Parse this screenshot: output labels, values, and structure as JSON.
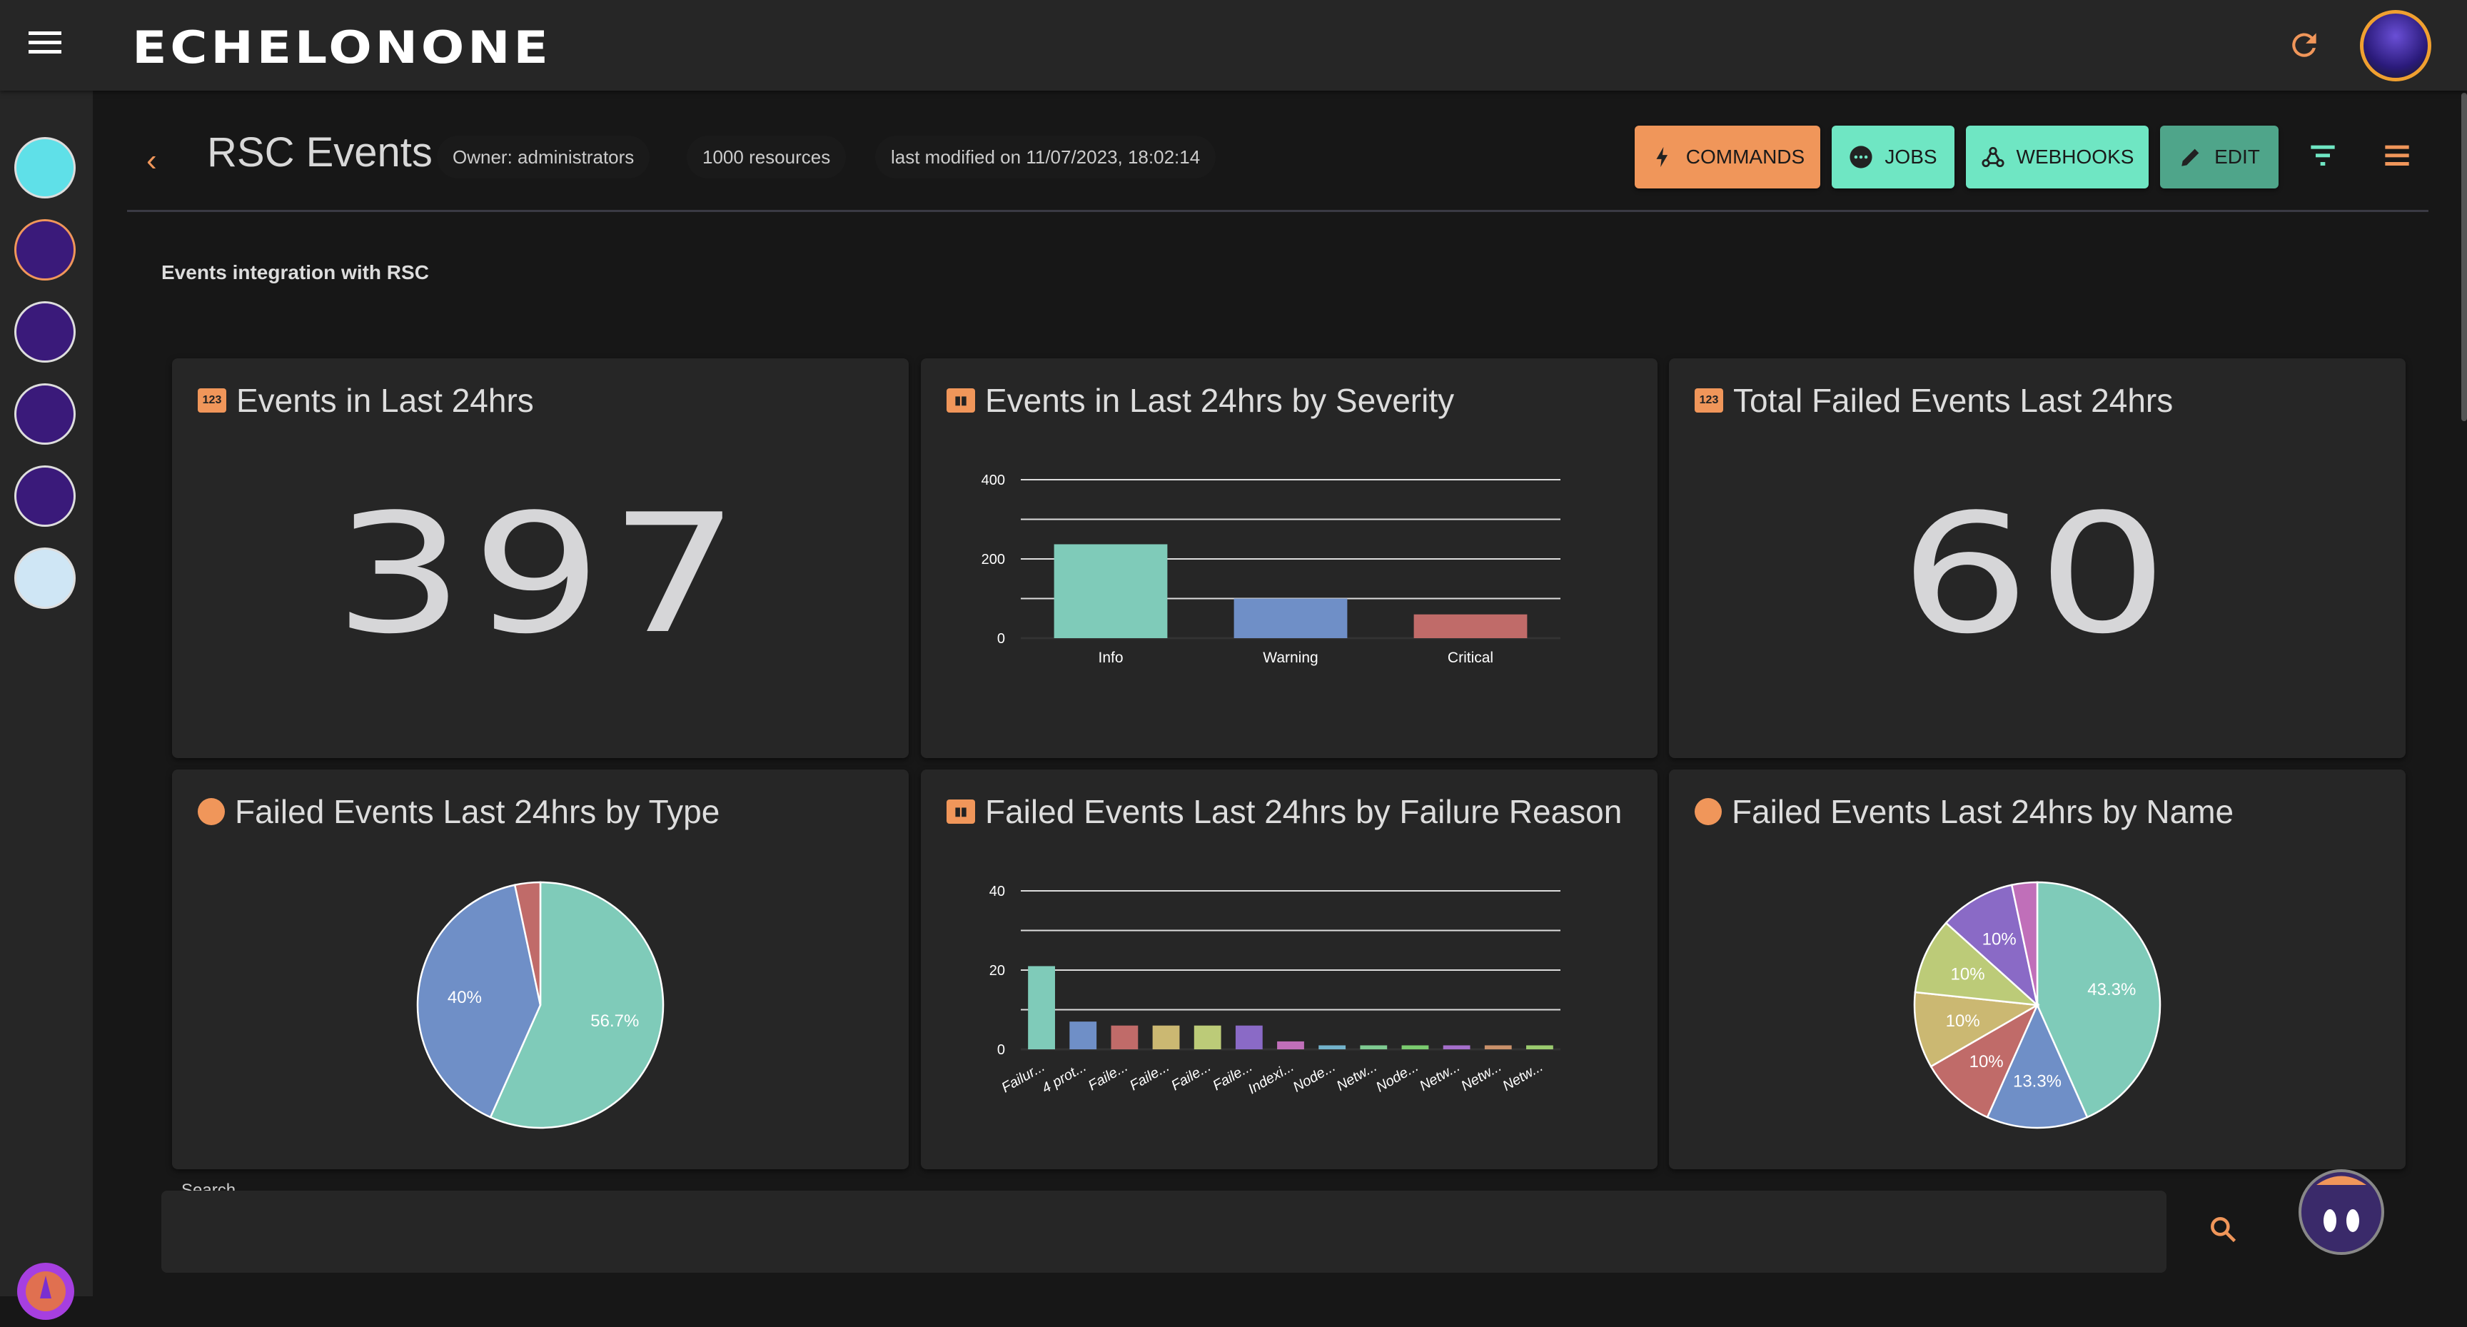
{
  "app": {
    "logo": "ECHELONONE"
  },
  "header": {
    "title": "RSC Events",
    "owner": "Owner: administrators",
    "resources": "1000 resources",
    "modified": "last modified on 11/07/2023, 18:02:14",
    "buttons": {
      "commands": "COMMANDS",
      "jobs": "JOBS",
      "webhooks": "WEBHOOKS",
      "edit": "EDIT"
    }
  },
  "subtitle": "Events integration with RSC",
  "colors": {
    "accent": "#f0965a",
    "mint": "#6fe6c3",
    "edit": "#4fa58a"
  },
  "cards": {
    "events_24h": {
      "title": "Events in Last 24hrs",
      "value": "397",
      "icon": "123"
    },
    "failed_total": {
      "title": "Total Failed Events Last 24hrs",
      "value": "60",
      "icon": "123"
    },
    "severity": {
      "title": "Events in Last 24hrs by Severity"
    },
    "by_type": {
      "title": "Failed Events Last 24hrs by Type"
    },
    "by_reason": {
      "title": "Failed Events Last 24hrs by Failure Reason"
    },
    "by_name": {
      "title": "Failed Events Last 24hrs by Name"
    }
  },
  "search": {
    "placeholder": "Search..."
  },
  "chart_data": [
    {
      "type": "bar",
      "title": "Events in Last 24hrs by Severity",
      "categories": [
        "Info",
        "Warning",
        "Critical"
      ],
      "values": [
        237,
        100,
        60
      ],
      "colors": [
        "#7fcbb9",
        "#6f8fc7",
        "#c06b69"
      ],
      "yticks": [
        0,
        200,
        400
      ],
      "ylim": [
        0,
        400
      ],
      "grid": true
    },
    {
      "type": "pie",
      "title": "Failed Events Last 24hrs by Type",
      "values": [
        34,
        24,
        2
      ],
      "labels": [
        "56.7%",
        "40%",
        ""
      ],
      "colors": [
        "#7fcbb9",
        "#6f8fc7",
        "#c06b69"
      ]
    },
    {
      "type": "bar",
      "title": "Failed Events Last 24hrs by Failure Reason",
      "categories": [
        "Failur...",
        "4 prot...",
        "Faile...",
        "Faile...",
        "Faile...",
        "Faile...",
        "Indexi...",
        "Node...",
        "Netw...",
        "Node...",
        "Netw...",
        "Netw...",
        "Netw..."
      ],
      "values": [
        21,
        7,
        6,
        6,
        6,
        6,
        2,
        1,
        1,
        1,
        1,
        1,
        1
      ],
      "colors": [
        "#7fcbb9",
        "#6f8fc7",
        "#c06b69",
        "#cbb872",
        "#bccb78",
        "#8a6ac6",
        "#c06fb9",
        "#73b3cb",
        "#7fcb92",
        "#7bcb6f",
        "#a56fcb",
        "#c9916a",
        "#9bcb6f"
      ],
      "yticks": [
        0,
        20,
        40
      ],
      "ylim": [
        0,
        40
      ],
      "grid": true
    },
    {
      "type": "pie",
      "title": "Failed Events Last 24hrs by Name",
      "values": [
        26,
        8,
        6,
        6,
        6,
        6,
        2
      ],
      "labels": [
        "43.3%",
        "13.3%",
        "10%",
        "10%",
        "10%",
        "10%",
        ""
      ],
      "colors": [
        "#7fcbb9",
        "#6f8fc7",
        "#c06b69",
        "#cbb872",
        "#bccb78",
        "#8a6ac6",
        "#c06fb9"
      ]
    }
  ]
}
